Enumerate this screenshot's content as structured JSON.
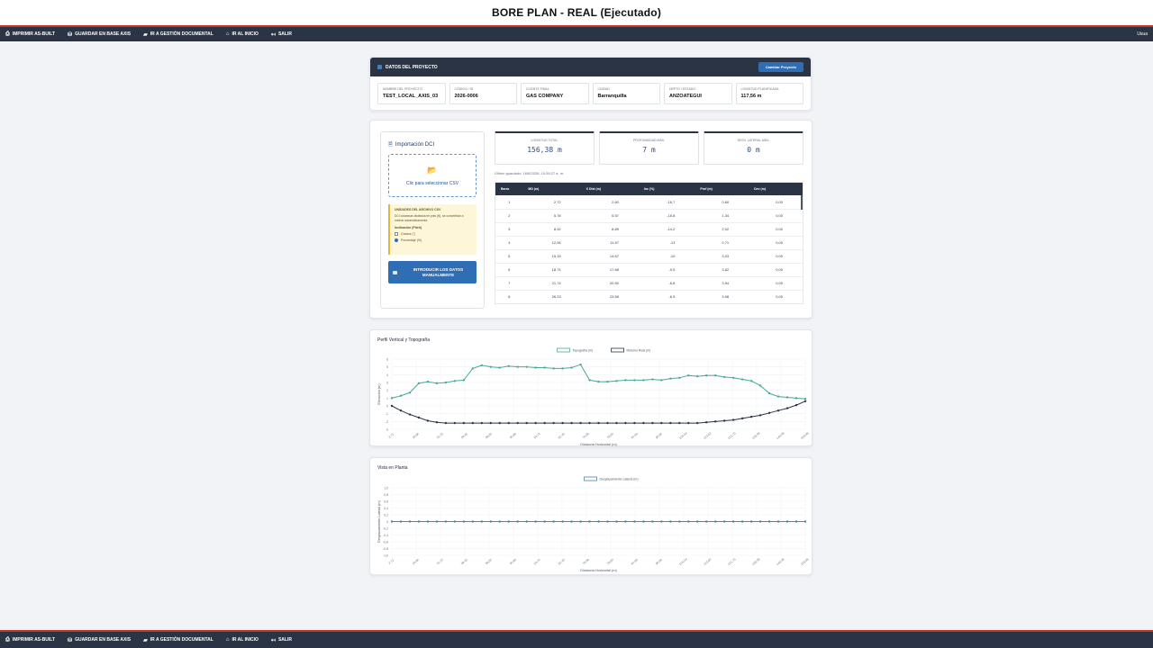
{
  "window": {
    "title": "BORE PLAN - REAL (Ejecutado)"
  },
  "toolbar": {
    "items": [
      {
        "icon": "printer-icon",
        "label": "IMPRIMIR AS-BUILT"
      },
      {
        "icon": "database-icon",
        "label": "GUARDAR EN BASE AXIS"
      },
      {
        "icon": "folder-icon",
        "label": "IR A GESTIÓN DOCUMENTAL"
      },
      {
        "icon": "home-icon",
        "label": "IR AL INICIO"
      },
      {
        "icon": "logout-icon",
        "label": "SALIR"
      }
    ],
    "user": "Usua"
  },
  "project": {
    "header": "DATOS DEL PROYECTO",
    "change_button": "Cambiar Proyecto",
    "fields": [
      {
        "label": "NOMBRE DEL PROYECTO",
        "value": "TEST_LOCAL_AXIS_03"
      },
      {
        "label": "CÓDIGO / ID",
        "value": "2026-0006"
      },
      {
        "label": "CLIENTE FINAL",
        "value": "GAS COMPANY"
      },
      {
        "label": "CIUDAD",
        "value": "Barranquilla"
      },
      {
        "label": "DEPTO / ESTADO",
        "value": "ANZOATEGUI"
      },
      {
        "label": "LONGITUD PLANIFICADA",
        "value": "117,56 m"
      }
    ]
  },
  "import": {
    "title": "Importación DCI",
    "dropzone": "Clic para seleccionar CSV",
    "notes_header": "UNIDADES DEL ARCHIVO CSV",
    "notes_text": "DCI columnas distancia en pies (ft), se convertirán a metros automáticamente.",
    "inclination_label": "Inclinación (Pitch)",
    "options": [
      {
        "label": "Grados (°)",
        "selected": false
      },
      {
        "label": "Porcentaje (%)",
        "selected": true
      }
    ],
    "manual_button": "INTRODUCIR LOS DATOS MANUALMENTE"
  },
  "stats": [
    {
      "label": "LONGITUD TOTAL",
      "value": "156,38 m"
    },
    {
      "label": "PROFUNDIDAD MÁX.",
      "value": "7 m"
    },
    {
      "label": "DESV. LATERAL MÁX.",
      "value": "0 m"
    }
  ],
  "saved_text": "Último guardado: 16/6/2026, 10:35:27 a. m.",
  "table": {
    "headers": [
      "Barra",
      "MD (m)",
      "X Dist (m)",
      "Inc (%)",
      "Prof (m)",
      "Dev (m)"
    ],
    "rows": [
      [
        "1",
        "2,72",
        "2,60",
        "-16,7",
        "0,60",
        "0,00"
      ],
      [
        "2",
        "5,78",
        "5,57",
        "-15,8",
        "1,34",
        "0,00"
      ],
      [
        "3",
        "8,92",
        "8,89",
        "-14,2",
        "2,02",
        "0,00"
      ],
      [
        "4",
        "12,06",
        "11,67",
        "-13",
        "2,71",
        "0,00"
      ],
      [
        "5",
        "15,15",
        "14,67",
        "-10",
        "3,03",
        "0,00"
      ],
      [
        "6",
        "18,74",
        "17,68",
        "-9,5",
        "3,62",
        "0,00"
      ],
      [
        "7",
        "21,74",
        "20,50",
        "-6,8",
        "3,94",
        "0,00"
      ],
      [
        "8",
        "26,23",
        "23,58",
        "-6,5",
        "3,98",
        "0,00"
      ]
    ]
  },
  "chart_data": [
    {
      "type": "line",
      "title": "Perfil Vertical y Topografía",
      "xlabel": "Distancia Horizontal (m)",
      "ylabel": "Elevación (m)",
      "ylim": [
        -3,
        6
      ],
      "legend": "top-center",
      "grid": true,
      "x_ticks": [
        "2,72",
        "10,86",
        "21,15",
        "29,45",
        "38,05",
        "45,89",
        "53,72",
        "61,45",
        "70,08",
        "78,60",
        "87,60",
        "95,66",
        "104,44",
        "113,62",
        "121,70",
        "130,39",
        "140,38",
        "150,08"
      ],
      "y_ticks": [
        "6",
        "5",
        "4",
        "3",
        "2",
        "1",
        "0",
        "-1",
        "-2",
        "-3"
      ],
      "series": [
        {
          "name": "Topografía (m)",
          "color": "#4aa99a",
          "values": [
            1,
            1.3,
            1.7,
            2.9,
            3.1,
            2.9,
            3.0,
            3.2,
            3.3,
            4.8,
            5.2,
            5.0,
            4.9,
            5.1,
            5.0,
            5.0,
            4.9,
            4.9,
            4.8,
            4.8,
            4.9,
            5.3,
            3.3,
            3.1,
            3.1,
            3.2,
            3.3,
            3.3,
            3.3,
            3.4,
            3.3,
            3.5,
            3.6,
            3.9,
            3.8,
            3.9,
            3.9,
            3.7,
            3.6,
            3.4,
            3.2,
            2.6,
            1.6,
            1.2,
            1.1,
            1.0,
            0.9
          ]
        },
        {
          "name": "Retorno Real (m)",
          "color": "#2b3444",
          "values": [
            0,
            -0.6,
            -1.1,
            -1.5,
            -1.9,
            -2.1,
            -2.2,
            -2.2,
            -2.2,
            -2.2,
            -2.2,
            -2.2,
            -2.2,
            -2.2,
            -2.2,
            -2.2,
            -2.2,
            -2.2,
            -2.2,
            -2.2,
            -2.2,
            -2.2,
            -2.2,
            -2.2,
            -2.2,
            -2.2,
            -2.2,
            -2.2,
            -2.2,
            -2.2,
            -2.2,
            -2.2,
            -2.2,
            -2.2,
            -2.2,
            -2.1,
            -2.0,
            -1.9,
            -1.8,
            -1.6,
            -1.4,
            -1.2,
            -0.9,
            -0.6,
            -0.3,
            0.1,
            0.6
          ]
        }
      ]
    },
    {
      "type": "line",
      "title": "Vista en Planta",
      "xlabel": "Distancia Horizontal (m)",
      "ylabel": "Desplazamiento Lateral (m)",
      "ylim": [
        -1,
        1
      ],
      "legend": "top-center",
      "grid": true,
      "x_ticks": [
        "2,72",
        "10,86",
        "21,15",
        "29,45",
        "38,05",
        "45,89",
        "53,72",
        "61,45",
        "70,08",
        "78,60",
        "87,60",
        "95,66",
        "104,44",
        "113,62",
        "121,70",
        "130,39",
        "140,38",
        "150,08"
      ],
      "y_ticks": [
        "1,0",
        "0,8",
        "0,6",
        "0,4",
        "0,2",
        "0",
        "-0,2",
        "-0,4",
        "-0,6",
        "-0,8",
        "-1,0"
      ],
      "series": [
        {
          "name": "Desplazamiento Lateral (m)",
          "color": "#4a86a9",
          "values": [
            0,
            0,
            0,
            0,
            0,
            0,
            0,
            0,
            0,
            0,
            0,
            0,
            0,
            0,
            0,
            0,
            0,
            0,
            0,
            0,
            0,
            0,
            0,
            0,
            0,
            0,
            0,
            0,
            0,
            0,
            0,
            0,
            0,
            0,
            0,
            0,
            0,
            0,
            0,
            0,
            0,
            0,
            0,
            0,
            0,
            0,
            0
          ]
        }
      ]
    }
  ]
}
